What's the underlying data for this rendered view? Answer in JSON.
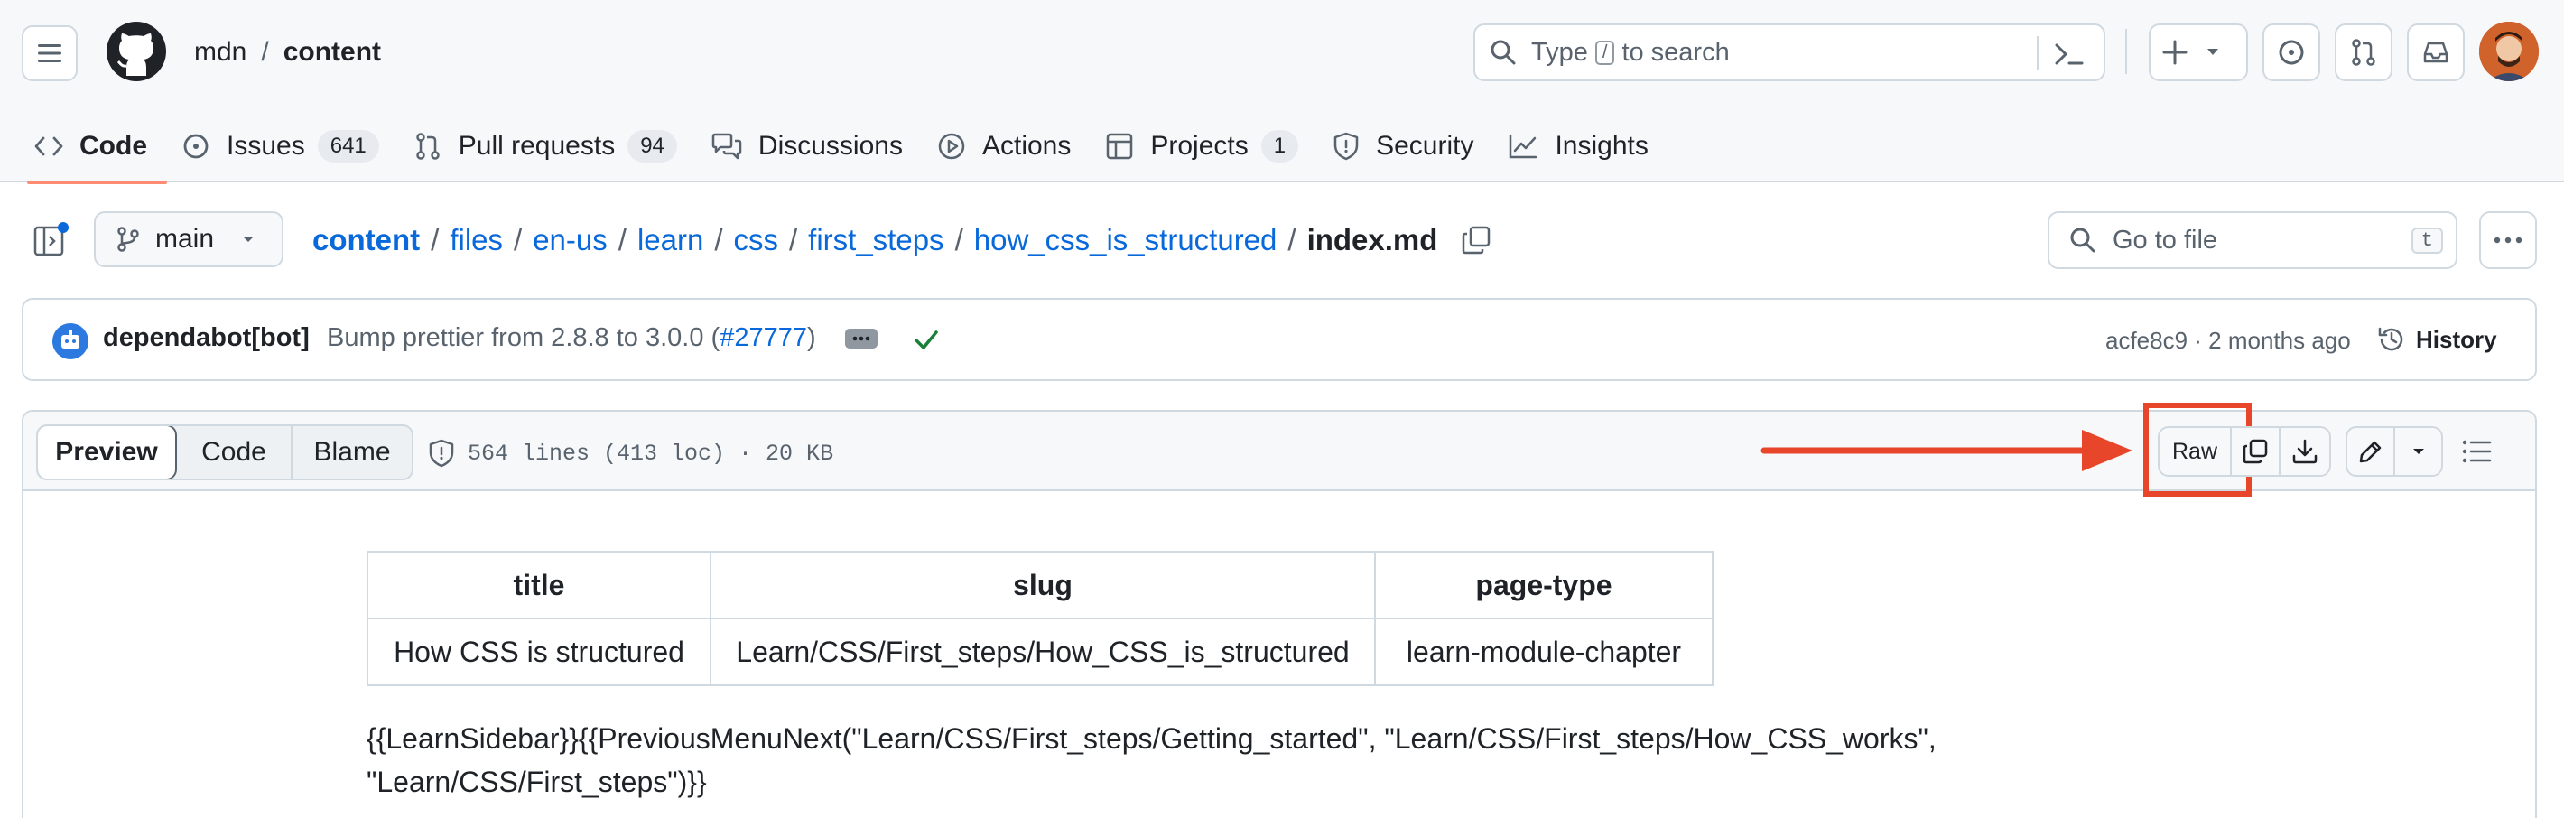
{
  "header": {
    "owner": "mdn",
    "sep": "/",
    "repo": "content",
    "search_prefix": "Type",
    "search_key": "/",
    "search_suffix": "to search"
  },
  "tabs": [
    {
      "label": "Code",
      "count": null
    },
    {
      "label": "Issues",
      "count": "641"
    },
    {
      "label": "Pull requests",
      "count": "94"
    },
    {
      "label": "Discussions",
      "count": null
    },
    {
      "label": "Actions",
      "count": null
    },
    {
      "label": "Projects",
      "count": "1"
    },
    {
      "label": "Security",
      "count": null
    },
    {
      "label": "Insights",
      "count": null
    }
  ],
  "file_nav": {
    "branch": "main",
    "path": [
      "content",
      "files",
      "en-us",
      "learn",
      "css",
      "first_steps",
      "how_css_is_structured"
    ],
    "filename": "index.md",
    "goto_placeholder": "Go to file",
    "goto_key": "t"
  },
  "commit": {
    "author": "dependabot[bot]",
    "message_prefix": "Bump prettier from 2.8.8 to 3.0.0 (",
    "pr_link": "#27777",
    "message_suffix": ")",
    "sha_time": "acfe8c9 · 2 months ago",
    "history_label": "History"
  },
  "file_header": {
    "view_tabs": [
      "Preview",
      "Code",
      "Blame"
    ],
    "info": "564 lines (413 loc) · 20 KB",
    "raw_label": "Raw"
  },
  "frontmatter": {
    "headers": [
      "title",
      "slug",
      "page-type"
    ],
    "row": [
      "How CSS is structured",
      "Learn/CSS/First_steps/How_CSS_is_structured",
      "learn-module-chapter"
    ]
  },
  "content": {
    "line1": "{{LearnSidebar}}{{PreviousMenuNext(\"Learn/CSS/First_steps/Getting_started\", \"Learn/CSS/First_steps/How_CSS_works\",",
    "line2": "\"Learn/CSS/First_steps\")}}"
  },
  "colors": {
    "accent_link": "#0969da",
    "annotation": "#e8462b",
    "tab_underline": "#fd8c73",
    "check": "#1a7f37"
  }
}
